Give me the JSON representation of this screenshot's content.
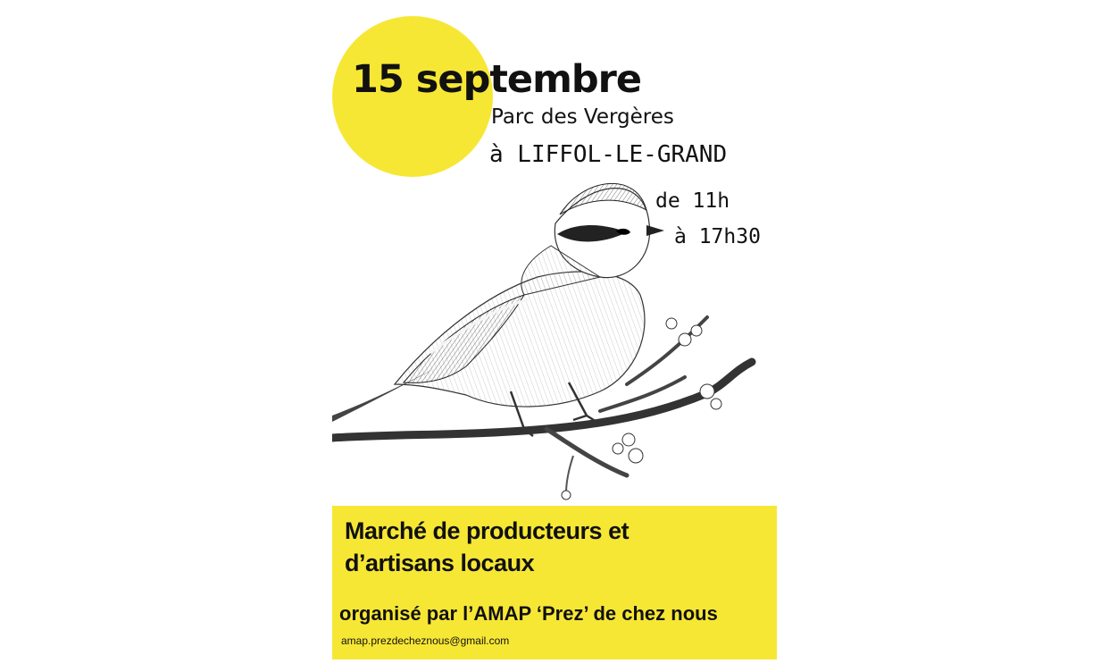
{
  "poster": {
    "date": "15 septembre",
    "venue": "Parc des Vergères",
    "town": "à LIFFOL-LE-GRAND",
    "time_from": "de 11h",
    "time_to": "à 17h30",
    "market_line1": "Marché de producteurs et",
    "market_line2": "d’artisans locaux",
    "organiser": "organisé par l’AMAP ‘Prez’ de chez nous",
    "email": "amap.prezdecheznous@gmail.com"
  },
  "colors": {
    "accent_yellow": "#f7e735",
    "text": "#111111",
    "background": "#ffffff"
  },
  "illustration": {
    "subject": "bird-on-branch-illustration"
  }
}
